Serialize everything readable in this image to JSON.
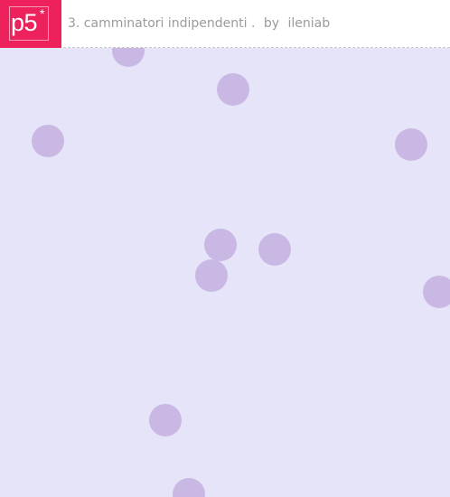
{
  "header": {
    "logo_text": "p5",
    "logo_star": "*",
    "sketch_title": "3. camminatori indipendenti .",
    "by_label": "by",
    "author": "ileniab"
  },
  "canvas": {
    "background_color": "#e6e4f9",
    "walker_color": "#c9b8e4",
    "walker_count": 11
  },
  "colors": {
    "brand": "#ed225d",
    "title_text": "#9b9b9b"
  }
}
